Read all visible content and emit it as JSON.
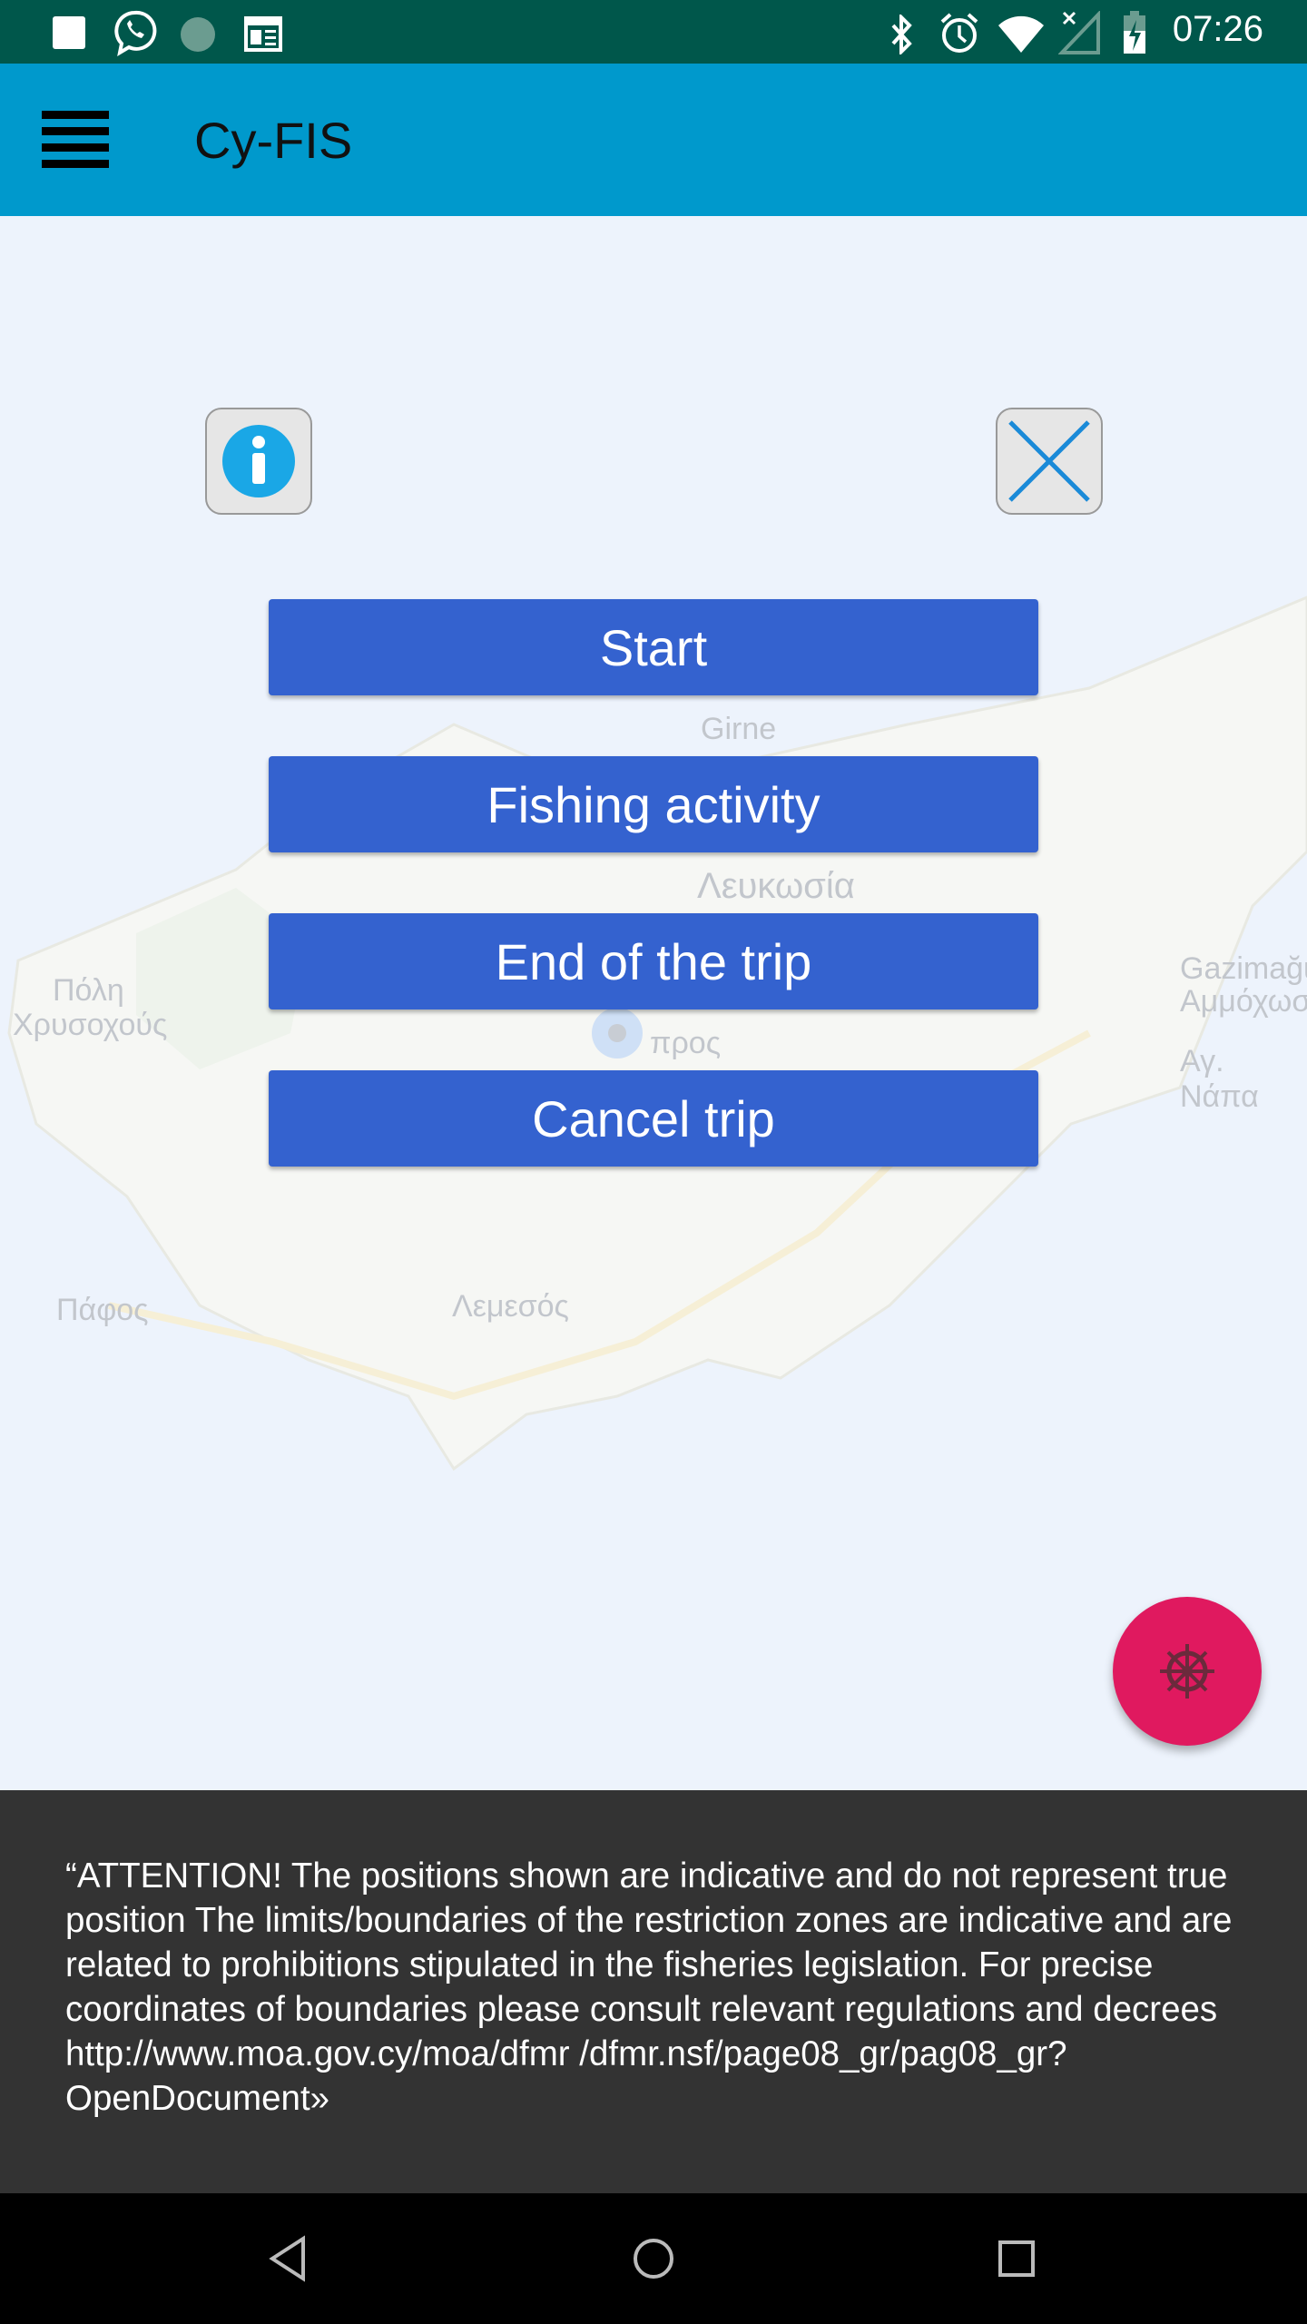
{
  "status_bar": {
    "time": "07:26",
    "icons": [
      "notification-square-icon",
      "viber-icon",
      "loading-icon",
      "news-icon",
      "bluetooth-icon",
      "alarm-icon",
      "wifi-icon",
      "no-signal-icon",
      "battery-charging-icon"
    ]
  },
  "toolbar": {
    "title": "Cy-FIS",
    "menu_icon": "hamburger-icon"
  },
  "map": {
    "labels": [
      "Girne",
      "Λευκωσία",
      "Πόλη",
      "Χρυσοχούς",
      "Gazimağu",
      "Αμμόχωσ",
      "Αγ. Νάπα",
      "προς",
      "Λεμεσός",
      "Πάφος"
    ]
  },
  "dialog": {
    "info_icon": "info-icon",
    "close_icon": "close-icon",
    "buttons": [
      "Start",
      "Fishing activity",
      "End of the trip",
      "Cancel trip"
    ]
  },
  "fab": {
    "icon": "ship-wheel-icon",
    "color": "#e0195f"
  },
  "footer": {
    "text": "“ATTENTION! The positions shown are indicative and do not represent true position The limits/boundaries of the restriction zones are indicative and are related to prohibitions stipulated in the fisheries legislation. For precise coordinates of boundaries please consult relevant regulations and decrees http://www.moa.gov.cy/moa/dfmr /dfmr.nsf/page08_gr/pag08_gr?OpenDocument»"
  },
  "colors": {
    "toolbar": "#0099cc",
    "status_bar": "#00574b",
    "button": "#3462cf",
    "footer": "#333333"
  }
}
